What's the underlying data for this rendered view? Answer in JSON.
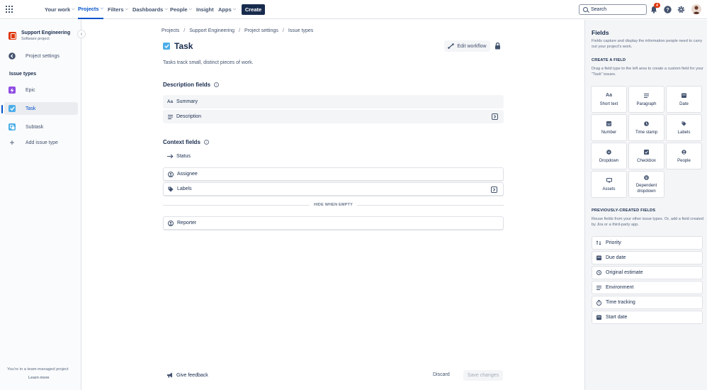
{
  "topnav": {
    "your_work": "Your work",
    "projects": "Projects",
    "filters": "Filters",
    "dashboards": "Dashboards",
    "people": "People",
    "insight": "Insight",
    "apps": "Apps",
    "create": "Create",
    "search_placeholder": "Search",
    "notification_count": "4",
    "accent": "#0052CC"
  },
  "sidebar": {
    "project_name": "Support Engineering",
    "project_type": "Software project",
    "project_settings": "Project settings",
    "issue_types_heading": "Issue types",
    "items": [
      {
        "label": "Epic",
        "icon": "epic-icon",
        "color": "#904EE2"
      },
      {
        "label": "Task",
        "icon": "task-icon",
        "color": "#4BADE8"
      },
      {
        "label": "Subtask",
        "icon": "subtask-icon",
        "color": "#4BADE8"
      },
      {
        "label": "Add issue type",
        "icon": "plus-icon"
      }
    ],
    "team_note": "You're in a team-managed project",
    "learn_more": "Learn more"
  },
  "main": {
    "breadcrumbs": [
      "Projects",
      "Support Engineering",
      "Project settings",
      "Issue types"
    ],
    "title": "Task",
    "edit_workflow": "Edit workflow",
    "description": "Tasks track small, distinct pieces of work.",
    "description_fields_heading": "Description fields",
    "description_fields": [
      "Summary",
      "Description"
    ],
    "context_fields_heading": "Context fields",
    "context_fields": [
      "Status",
      "Assignee",
      "Labels"
    ],
    "hide_when_empty": "HIDE WHEN EMPTY",
    "hidden_fields": [
      "Reporter"
    ],
    "give_feedback": "Give feedback",
    "discard": "Discard",
    "save_changes": "Save changes"
  },
  "panel": {
    "title": "Fields",
    "intro": "Fields capture and display the information people need to carry out your project's work.",
    "create_heading": "CREATE A FIELD",
    "create_text": "Drag a field type to the left area to create a custom field for your \"Task\" issues.",
    "field_types": [
      {
        "label": "Short text",
        "icon": "short-text-icon"
      },
      {
        "label": "Paragraph",
        "icon": "paragraph-icon"
      },
      {
        "label": "Date",
        "icon": "calendar-icon"
      },
      {
        "label": "Number",
        "icon": "number-icon"
      },
      {
        "label": "Time stamp",
        "icon": "clock-icon"
      },
      {
        "label": "Labels",
        "icon": "label-icon"
      },
      {
        "label": "Dropdown",
        "icon": "dropdown-icon"
      },
      {
        "label": "Checkbox",
        "icon": "checkbox-icon"
      },
      {
        "label": "People",
        "icon": "person-icon"
      },
      {
        "label": "Assets",
        "icon": "assets-icon"
      },
      {
        "label": "Dependent dropdown",
        "icon": "dependent-dropdown-icon"
      }
    ],
    "previous_heading": "PREVIOUSLY-CREATED FIELDS",
    "previous_text": "Reuse fields from your other issue types. Or, add a field created by Jira or a third-party app.",
    "previous_fields": [
      "Priority",
      "Due date",
      "Original estimate",
      "Environment",
      "Time tracking",
      "Start date"
    ]
  }
}
